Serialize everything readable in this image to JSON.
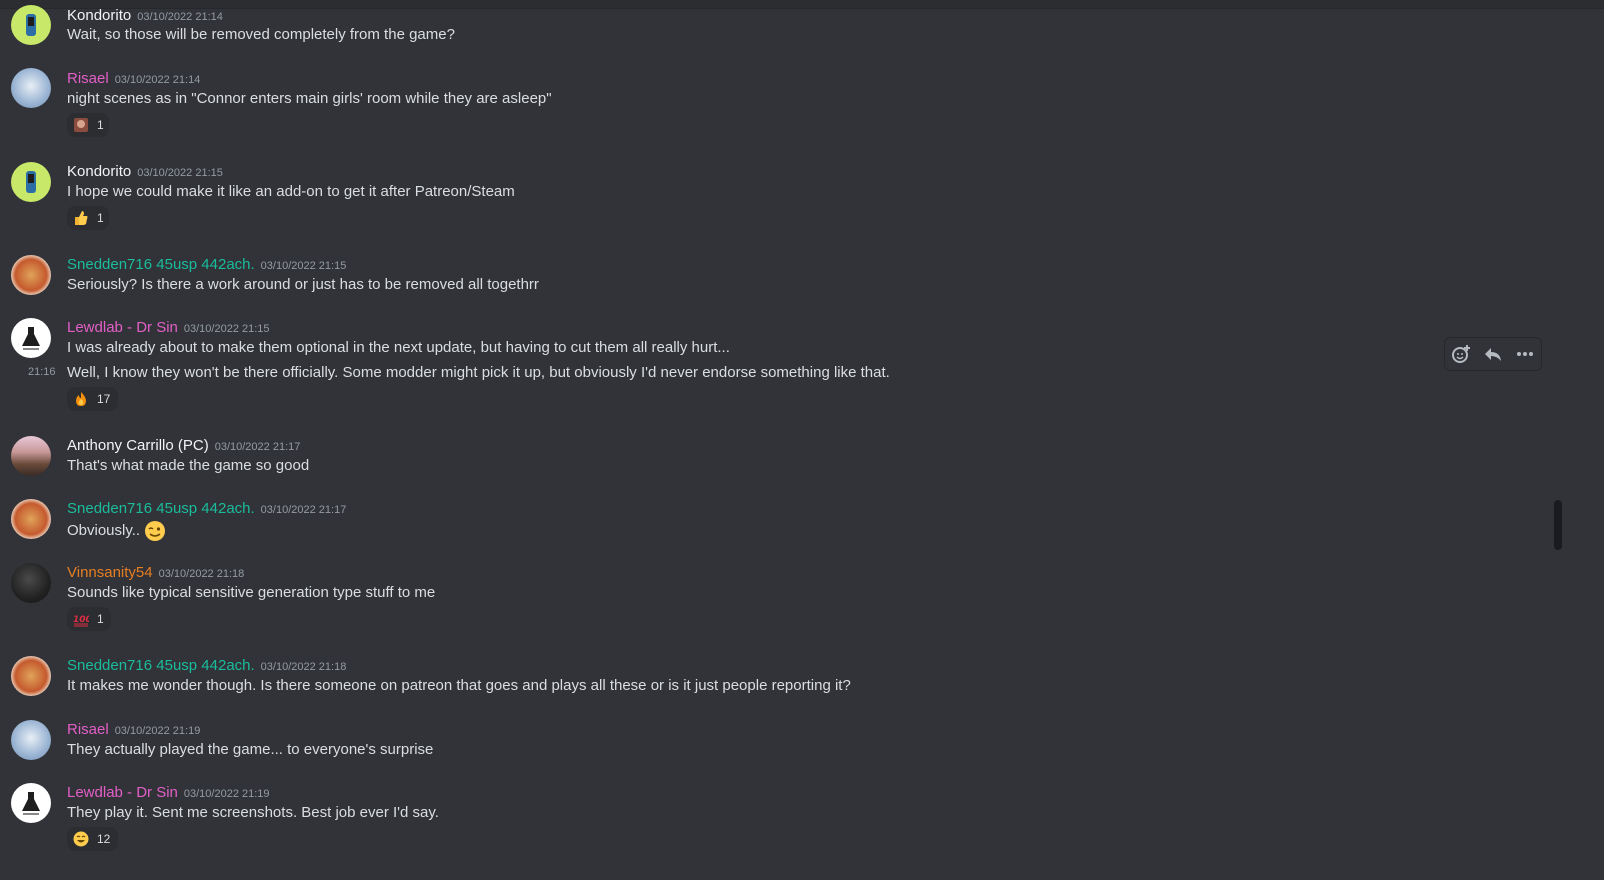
{
  "colors": {
    "background": "#313338",
    "white_name": "#f2f3f5",
    "pink_name": "#e35fc7",
    "teal_name": "#1abc9c",
    "orange_name": "#e67e22"
  },
  "messages": [
    {
      "author": "Kondorito",
      "time": "03/10/2022 21:14",
      "text": "Wait, so those will be removed completely from the game?",
      "avatar": "kondorito-avatar"
    },
    {
      "author": "Risael",
      "time": "03/10/2022 21:14",
      "text": "night scenes as in \"Connor enters main girls' room while they are asleep\"",
      "reaction": {
        "emoji": "custom-face-emoji",
        "count": "1"
      },
      "avatar": "risael-avatar"
    },
    {
      "author": "Kondorito",
      "time": "03/10/2022 21:15",
      "text": "I hope we could make it like an add-on to get it after Patreon/Steam",
      "reaction": {
        "emoji": "thumbs-up-emoji",
        "count": "1"
      },
      "avatar": "kondorito-avatar"
    },
    {
      "author": "Snedden716 45usp 442ach.",
      "time": "03/10/2022 21:15",
      "text": "Seriously? Is there a work around or just has to be removed all togethrr",
      "avatar": "snedden-avatar"
    },
    {
      "author": "Lewdlab - Dr Sin",
      "time": "03/10/2022 21:15",
      "text": "I was already about to make them optional in the next update, but having to cut them all really hurt...",
      "avatar": "lewdlab-avatar",
      "followup": {
        "time": "21:16",
        "text": "Well, I know they won't be there officially. Some modder might pick it up, but obviously I'd never endorse something like that."
      },
      "reaction": {
        "emoji": "fire-emoji",
        "count": "17"
      }
    },
    {
      "author": "Anthony Carrillo (PC)",
      "time": "03/10/2022 21:17",
      "text": "That's what made the game so good",
      "avatar": "anthony-avatar"
    },
    {
      "author": "Snedden716 45usp 442ach.",
      "time": "03/10/2022 21:17",
      "text": "Obviously..",
      "avatar": "snedden-avatar",
      "inline_emoji": "wink-emoji"
    },
    {
      "author": "Vinnsanity54",
      "time": "03/10/2022 21:18",
      "text": "Sounds like typical sensitive generation type stuff to me",
      "reaction": {
        "emoji": "hundred-points-emoji",
        "count": "1"
      },
      "avatar": "vinnsanity-avatar"
    },
    {
      "author": "Snedden716 45usp 442ach.",
      "time": "03/10/2022 21:18",
      "text": "It makes me wonder though. Is there someone on patreon that goes and plays all these or is it just people reporting it?",
      "avatar": "snedden-avatar"
    },
    {
      "author": "Risael",
      "time": "03/10/2022 21:19",
      "text": "They actually played the game... to everyone's surprise",
      "avatar": "risael-avatar"
    },
    {
      "author": "Lewdlab - Dr Sin",
      "time": "03/10/2022 21:19",
      "text": "They play it. Sent me screenshots. Best job ever I'd say.",
      "reaction": {
        "emoji": "grin-emoji",
        "count": "12"
      },
      "avatar": "lewdlab-avatar"
    }
  ],
  "toolbar": {
    "icons": [
      "add-reaction-icon",
      "reply-icon",
      "more-options-icon"
    ]
  }
}
